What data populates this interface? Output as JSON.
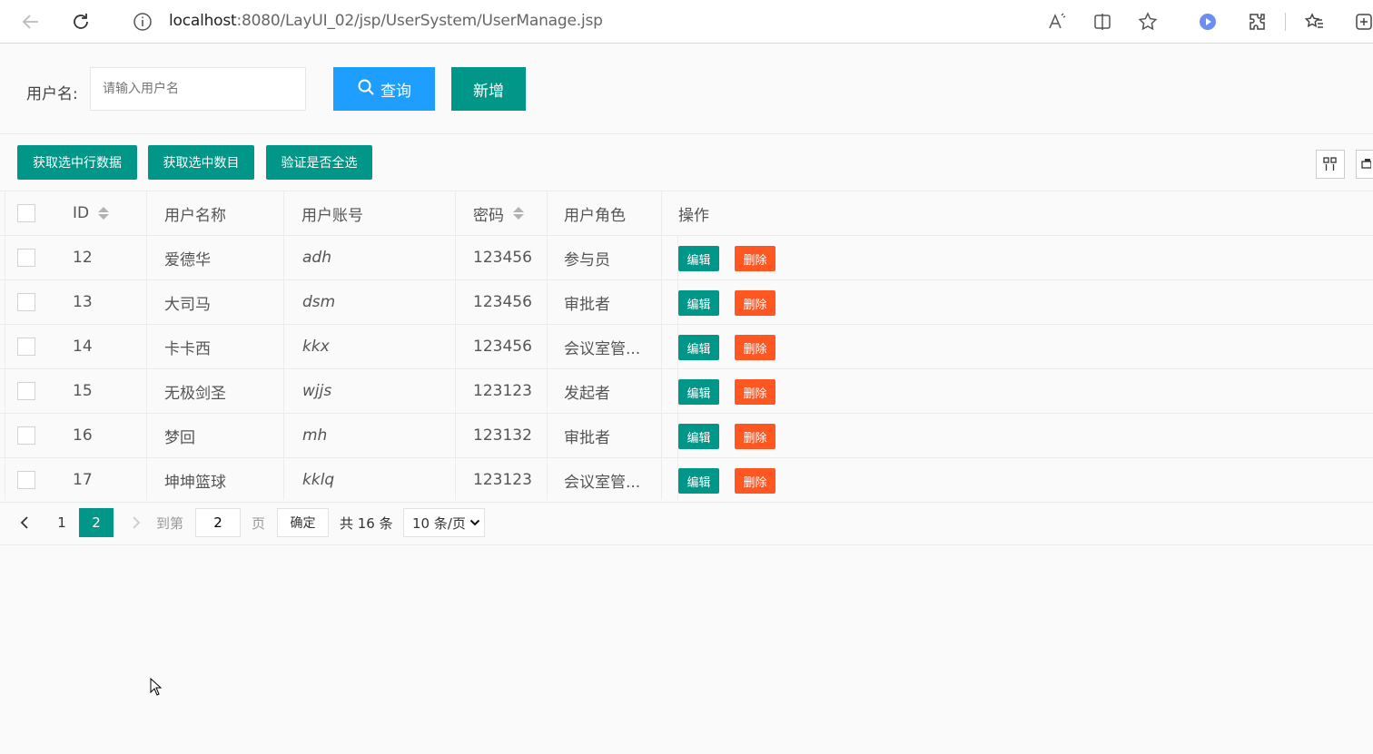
{
  "browser": {
    "url_host": "localhost",
    "url_rest": ":8080/LayUI_02/jsp/UserSystem/UserManage.jsp"
  },
  "search": {
    "label": "用户名:",
    "placeholder": "请输入用户名",
    "value": "",
    "query_label": "查询",
    "add_label": "新增"
  },
  "toolbar": {
    "buttons": [
      "获取选中行数据",
      "获取选中数目",
      "验证是否全选"
    ]
  },
  "table": {
    "columns": [
      "ID",
      "用户名称",
      "用户账号",
      "密码",
      "用户角色",
      "操作"
    ],
    "rows": [
      {
        "id": "12",
        "name": "爱德华",
        "account": "adh",
        "password": "123456",
        "role": "参与员"
      },
      {
        "id": "13",
        "name": "大司马",
        "account": "dsm",
        "password": "123456",
        "role": "审批者"
      },
      {
        "id": "14",
        "name": "卡卡西",
        "account": "kkx",
        "password": "123456",
        "role": "会议室管..."
      },
      {
        "id": "15",
        "name": "无极剑圣",
        "account": "wjjs",
        "password": "123123",
        "role": "发起者"
      },
      {
        "id": "16",
        "name": "梦回",
        "account": "mh",
        "password": "123132",
        "role": "审批者"
      },
      {
        "id": "17",
        "name": "坤坤篮球",
        "account": "kklq",
        "password": "123123",
        "role": "会议室管..."
      }
    ],
    "edit_label": "编辑",
    "delete_label": "删除"
  },
  "pagination": {
    "pages": [
      "1",
      "2"
    ],
    "current": "2",
    "goto_label": "到第",
    "goto_value": "2",
    "page_unit": "页",
    "confirm_label": "确定",
    "total_label": "共 16 条",
    "page_size": "10 条/页"
  },
  "colors": {
    "primary": "#009688",
    "blue": "#1e9fff",
    "danger": "#ff5722"
  }
}
